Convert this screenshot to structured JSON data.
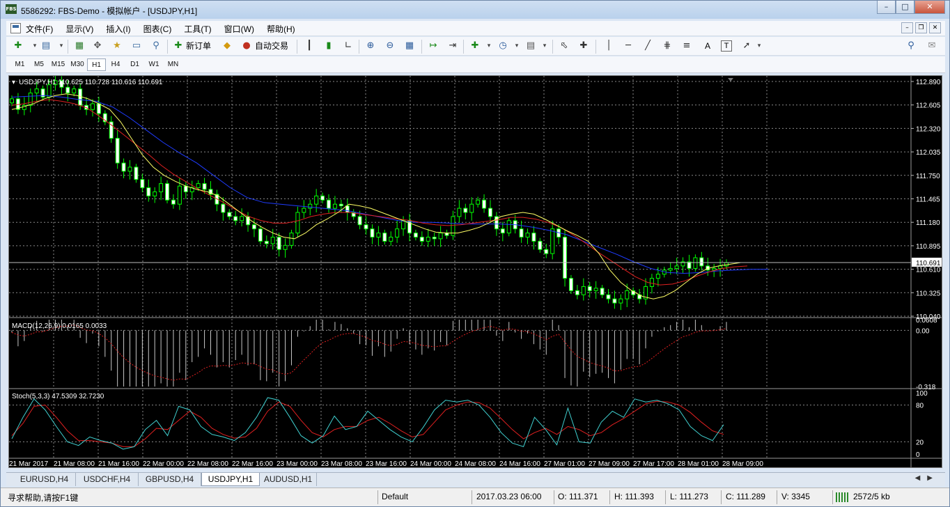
{
  "window": {
    "title": "5586292: FBS-Demo - 模拟帐户 - [USDJPY,H1]",
    "icon_label": "FBS",
    "buttons": [
      "minimize-icon",
      "maximize-icon",
      "close-icon"
    ]
  },
  "menu": {
    "items": [
      "文件(F)",
      "显示(V)",
      "插入(I)",
      "图表(C)",
      "工具(T)",
      "窗口(W)",
      "帮助(H)"
    ]
  },
  "toolbar": {
    "new_order": "新订单",
    "auto_trading": "自动交易",
    "text_tool": "A",
    "label_tool": "T"
  },
  "timeframes": [
    "M1",
    "M5",
    "M15",
    "M30",
    "H1",
    "H4",
    "D1",
    "W1",
    "MN"
  ],
  "active_timeframe": "H1",
  "chart": {
    "header": "USDJPY,H1  110.625 110.728 110.616 110.691",
    "price_ticks": [
      "112.890",
      "112.605",
      "112.320",
      "112.035",
      "111.750",
      "111.465",
      "111.180",
      "110.895",
      "110.610",
      "110.325",
      "110.040"
    ],
    "current_price": "110.691",
    "macd_label": "MACD(12,26,9) 0.0165 0.0033",
    "macd_ticks": [
      "0.0608",
      "0.00",
      "-0.318"
    ],
    "stoch_label": "Stoch(5,3,3) 47.5309 32.7230",
    "stoch_ticks": [
      "100",
      "80",
      "20",
      "0"
    ],
    "time_ticks": [
      "21 Mar 2017",
      "21 Mar 08:00",
      "21 Mar 16:00",
      "22 Mar 00:00",
      "22 Mar 08:00",
      "22 Mar 16:00",
      "23 Mar 00:00",
      "23 Mar 08:00",
      "23 Mar 16:00",
      "24 Mar 00:00",
      "24 Mar 08:00",
      "24 Mar 16:00",
      "27 Mar 01:00",
      "27 Mar 09:00",
      "27 Mar 17:00",
      "28 Mar 01:00",
      "28 Mar 09:00"
    ],
    "colors": {
      "background": "#000000",
      "grid": "#8a8a8a",
      "candle": "#00ff00",
      "ma_fast": "#ffff66",
      "ma_mid": "#e02020",
      "ma_slow": "#1f3cff",
      "macd_hist": "#c8c8c8",
      "macd_signal": "#e02020",
      "stoch_main": "#40d0d0",
      "stoch_signal": "#e02020"
    }
  },
  "chart_data": {
    "type": "candlestick",
    "symbol": "USDJPY",
    "timeframe": "H1",
    "ylim": [
      110.04,
      112.89
    ],
    "close": [
      112.68,
      112.55,
      112.6,
      112.75,
      112.8,
      112.7,
      112.85,
      112.9,
      112.82,
      112.75,
      112.8,
      112.6,
      112.55,
      112.62,
      112.5,
      112.4,
      112.2,
      111.9,
      111.8,
      111.85,
      111.7,
      111.6,
      111.5,
      111.55,
      111.65,
      111.45,
      111.4,
      111.62,
      111.55,
      111.6,
      111.65,
      111.58,
      111.52,
      111.4,
      111.3,
      111.25,
      111.2,
      111.25,
      111.15,
      111.1,
      110.95,
      110.92,
      111.0,
      110.85,
      110.9,
      111.05,
      111.3,
      111.35,
      111.4,
      111.5,
      111.45,
      111.35,
      111.4,
      111.38,
      111.3,
      111.25,
      111.15,
      111.1,
      111.0,
      111.05,
      110.95,
      111.0,
      111.1,
      111.2,
      111.05,
      111.0,
      110.95,
      111.0,
      110.98,
      111.05,
      111.02,
      111.25,
      111.35,
      111.3,
      111.4,
      111.45,
      111.35,
      111.25,
      111.1,
      111.05,
      111.2,
      111.1,
      111.0,
      111.05,
      110.95,
      110.85,
      110.8,
      111.1,
      111.0,
      110.5,
      110.35,
      110.3,
      110.4,
      110.35,
      110.38,
      110.3,
      110.25,
      110.2,
      110.25,
      110.35,
      110.3,
      110.25,
      110.4,
      110.5,
      110.55,
      110.6,
      110.62,
      110.65,
      110.7,
      110.62,
      110.75,
      110.65,
      110.6,
      110.62,
      110.65,
      110.69
    ],
    "ma_fast": [
      112.55,
      112.58,
      112.62,
      112.68,
      112.72,
      112.74,
      112.72,
      112.68,
      112.62,
      112.55,
      112.4,
      112.2,
      112.0,
      111.85,
      111.75,
      111.68,
      111.62,
      111.58,
      111.55,
      111.5,
      111.4,
      111.3,
      111.2,
      111.12,
      111.05,
      111.0,
      110.98,
      111.05,
      111.15,
      111.22,
      111.3,
      111.4,
      111.38,
      111.35,
      111.3,
      111.25,
      111.2,
      111.15,
      111.1,
      111.06,
      111.05,
      111.05,
      111.08,
      111.12,
      111.18,
      111.25,
      111.28,
      111.3,
      111.28,
      111.22,
      111.15,
      111.08,
      111.02,
      110.95,
      110.8,
      110.6,
      110.45,
      110.35,
      110.28,
      110.25,
      110.28,
      110.35,
      110.45,
      110.55,
      110.62,
      110.65,
      110.67,
      110.69
    ],
    "ma_mid": [
      112.6,
      112.62,
      112.65,
      112.67,
      112.65,
      112.62,
      112.57,
      112.47,
      112.36,
      112.24,
      112.12,
      112.0,
      111.87,
      111.76,
      111.67,
      111.58,
      111.5,
      111.42,
      111.33,
      111.25,
      111.2,
      111.17,
      111.17,
      111.2,
      111.25,
      111.28,
      111.3,
      111.3,
      111.28,
      111.26,
      111.24,
      111.22,
      111.2,
      111.17,
      111.15,
      111.14,
      111.15,
      111.17,
      111.19,
      111.21,
      111.24,
      111.24,
      111.22,
      111.18,
      111.12,
      111.03,
      110.93,
      110.82,
      110.72,
      110.62,
      110.52,
      110.45,
      110.42,
      110.43,
      110.47,
      110.53,
      110.58,
      110.62,
      110.64,
      110.65
    ],
    "ma_slow": [
      112.7,
      112.71,
      112.72,
      112.7,
      112.67,
      112.65,
      112.58,
      112.45,
      112.3,
      112.15,
      112.02,
      111.9,
      111.75,
      111.6,
      111.48,
      111.42,
      111.4,
      111.38,
      111.36,
      111.34,
      111.32,
      111.28,
      111.24,
      111.2,
      111.18,
      111.18,
      111.17,
      111.16,
      111.16,
      111.16,
      111.15,
      111.12,
      111.08,
      111.03,
      110.95,
      110.87,
      110.79,
      110.7,
      110.62,
      110.57,
      110.56,
      110.57,
      110.59,
      110.6,
      110.61,
      110.61
    ],
    "macd_ylim": [
      -0.318,
      0.0608
    ],
    "stoch_ylim": [
      0,
      100
    ],
    "stoch_main": [
      25,
      60,
      90,
      72,
      45,
      20,
      14,
      28,
      22,
      18,
      8,
      12,
      40,
      55,
      30,
      78,
      72,
      45,
      32,
      28,
      22,
      35,
      60,
      92,
      88,
      60,
      30,
      18,
      30,
      62,
      40,
      45,
      70,
      55,
      40,
      28,
      20,
      44,
      72,
      88,
      85,
      88,
      80,
      60,
      35,
      18,
      12,
      60,
      40,
      15,
      75,
      20,
      18,
      52,
      70,
      60,
      90,
      85,
      88,
      82,
      72,
      45,
      30,
      22,
      48
    ],
    "stoch_signal": [
      30,
      50,
      78,
      80,
      60,
      38,
      22,
      22,
      20,
      18,
      12,
      12,
      25,
      42,
      40,
      55,
      70,
      60,
      42,
      32,
      26,
      28,
      42,
      70,
      85,
      78,
      55,
      35,
      28,
      40,
      45,
      45,
      55,
      60,
      50,
      38,
      28,
      32,
      52,
      72,
      80,
      85,
      84,
      75,
      58,
      40,
      25,
      35,
      42,
      32,
      45,
      40,
      30,
      35,
      48,
      58,
      70,
      82,
      86,
      85,
      80,
      68,
      52,
      38,
      32
    ]
  },
  "tabs": [
    "EURUSD,H4",
    "USDCHF,H4",
    "GBPUSD,H4",
    "USDJPY,H1",
    "AUDUSD,H1"
  ],
  "active_tab": "USDJPY,H1",
  "status": {
    "help": "寻求帮助,请按F1键",
    "profile": "Default",
    "datetime": "2017.03.23 06:00",
    "open": "O: 111.371",
    "high": "H: 111.393",
    "low": "L: 111.273",
    "close": "C: 111.289",
    "volume": "V: 3345",
    "traffic": "2572/5 kb"
  }
}
